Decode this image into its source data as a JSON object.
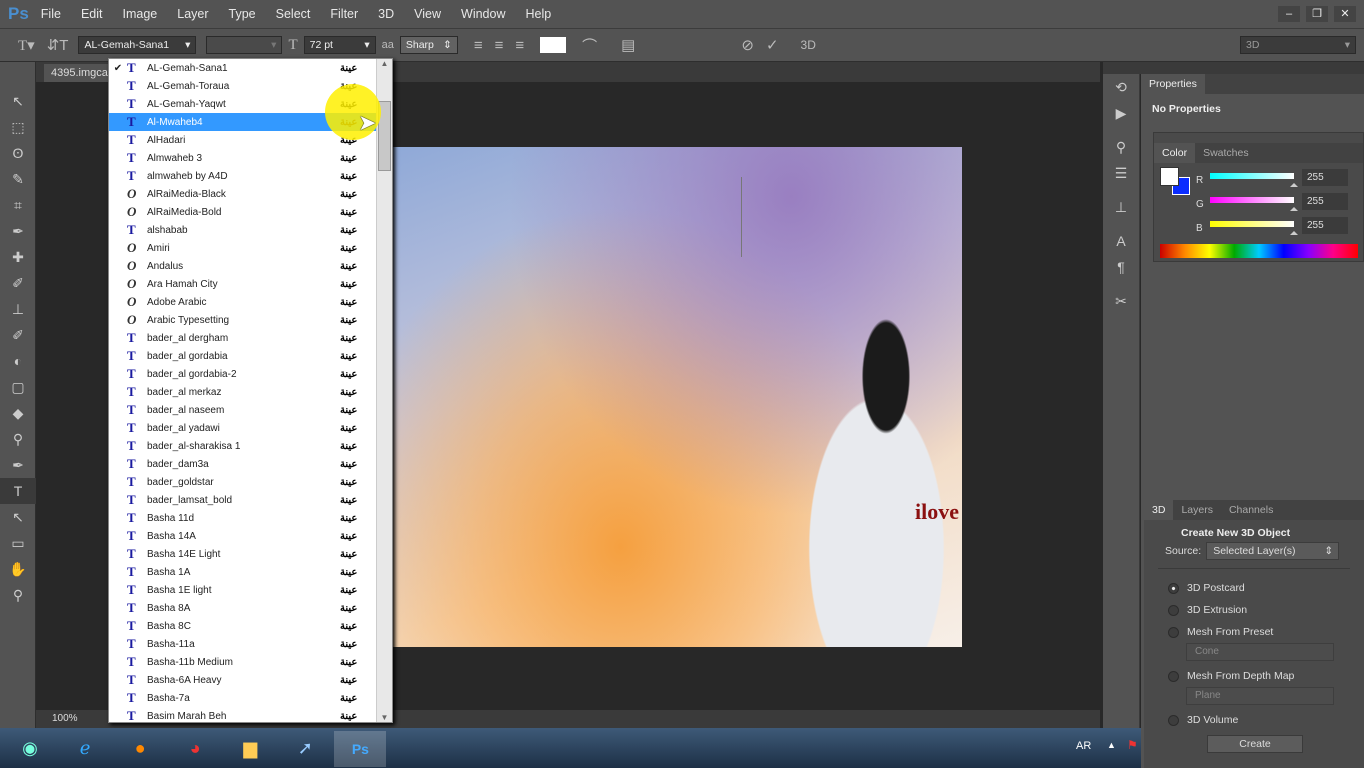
{
  "app": {
    "logo": "Ps",
    "menu": [
      "File",
      "Edit",
      "Image",
      "Layer",
      "Type",
      "Select",
      "Filter",
      "3D",
      "View",
      "Window",
      "Help"
    ]
  },
  "options": {
    "font_family": "AL-Gemah-Sana1",
    "font_style": "",
    "font_size": "72 pt",
    "antialias": "Sharp",
    "workspace": "3D",
    "mode_label": "3D"
  },
  "document": {
    "tab": "4395.imgca",
    "zoom": "100%",
    "text_layer": "ilove"
  },
  "font_menu": {
    "sample": "عينة",
    "selected_index": 3,
    "checked_index": 0,
    "items": [
      {
        "n": "AL-Gemah-Sana1",
        "t": "tt"
      },
      {
        "n": "AL-Gemah-Toraua",
        "t": "tt"
      },
      {
        "n": "AL-Gemah-Yaqwt",
        "t": "tt"
      },
      {
        "n": "Al-Mwaheb4",
        "t": "tt"
      },
      {
        "n": "AlHadari",
        "t": "tt"
      },
      {
        "n": "Almwaheb 3",
        "t": "tt"
      },
      {
        "n": "almwaheb by A4D",
        "t": "tt"
      },
      {
        "n": "AlRaiMedia-Black",
        "t": "ot"
      },
      {
        "n": "AlRaiMedia-Bold",
        "t": "ot"
      },
      {
        "n": "alshabab",
        "t": "tt"
      },
      {
        "n": "Amiri",
        "t": "ot"
      },
      {
        "n": "Andalus",
        "t": "ot"
      },
      {
        "n": "Ara Hamah City",
        "t": "ot"
      },
      {
        "n": "Adobe Arabic",
        "t": "ot"
      },
      {
        "n": "Arabic Typesetting",
        "t": "ot"
      },
      {
        "n": "bader_al dergham",
        "t": "tt"
      },
      {
        "n": "bader_al gordabia",
        "t": "tt"
      },
      {
        "n": "bader_al gordabia-2",
        "t": "tt"
      },
      {
        "n": "bader_al merkaz",
        "t": "tt"
      },
      {
        "n": "bader_al naseem",
        "t": "tt"
      },
      {
        "n": "bader_al yadawi",
        "t": "tt"
      },
      {
        "n": "bader_al-sharakisa 1",
        "t": "tt"
      },
      {
        "n": "bader_dam3a",
        "t": "tt"
      },
      {
        "n": "bader_goldstar",
        "t": "tt"
      },
      {
        "n": "bader_lamsat_bold",
        "t": "tt"
      },
      {
        "n": "Basha 11d",
        "t": "tt"
      },
      {
        "n": "Basha 14A",
        "t": "tt"
      },
      {
        "n": "Basha 14E Light",
        "t": "tt"
      },
      {
        "n": "Basha 1A",
        "t": "tt"
      },
      {
        "n": "Basha 1E light",
        "t": "tt"
      },
      {
        "n": "Basha 8A",
        "t": "tt"
      },
      {
        "n": "Basha 8C",
        "t": "tt"
      },
      {
        "n": "Basha-11a",
        "t": "tt"
      },
      {
        "n": "Basha-11b Medium",
        "t": "tt"
      },
      {
        "n": "Basha-6A Heavy",
        "t": "tt"
      },
      {
        "n": "Basha-7a",
        "t": "tt"
      },
      {
        "n": "Basim Marah Beh",
        "t": "tt"
      }
    ]
  },
  "properties": {
    "tab": "Properties",
    "message": "No Properties"
  },
  "color_panel": {
    "tabs": [
      "Color",
      "Swatches"
    ],
    "channels": [
      {
        "label": "R",
        "value": "255",
        "grad": "linear-gradient(90deg,#00ffff,#ffffff)"
      },
      {
        "label": "G",
        "value": "255",
        "grad": "linear-gradient(90deg,#ff00ff,#ffffff)"
      },
      {
        "label": "B",
        "value": "255",
        "grad": "linear-gradient(90deg,#ffff00,#ffffff)"
      }
    ],
    "foreground": "#ffffff",
    "background": "#0a2cff"
  },
  "panel3d": {
    "tabs": [
      "3D",
      "Layers",
      "Channels"
    ],
    "title": "Create New 3D Object",
    "source_label": "Source:",
    "source_value": "Selected Layer(s)",
    "options": [
      "3D Postcard",
      "3D Extrusion",
      "Mesh From Preset",
      "Mesh From Depth Map",
      "3D Volume"
    ],
    "selected_option": 0,
    "preset_value": "Cone",
    "depth_value": "Plane",
    "create": "Create"
  },
  "taskbar": {
    "language": "AR"
  }
}
